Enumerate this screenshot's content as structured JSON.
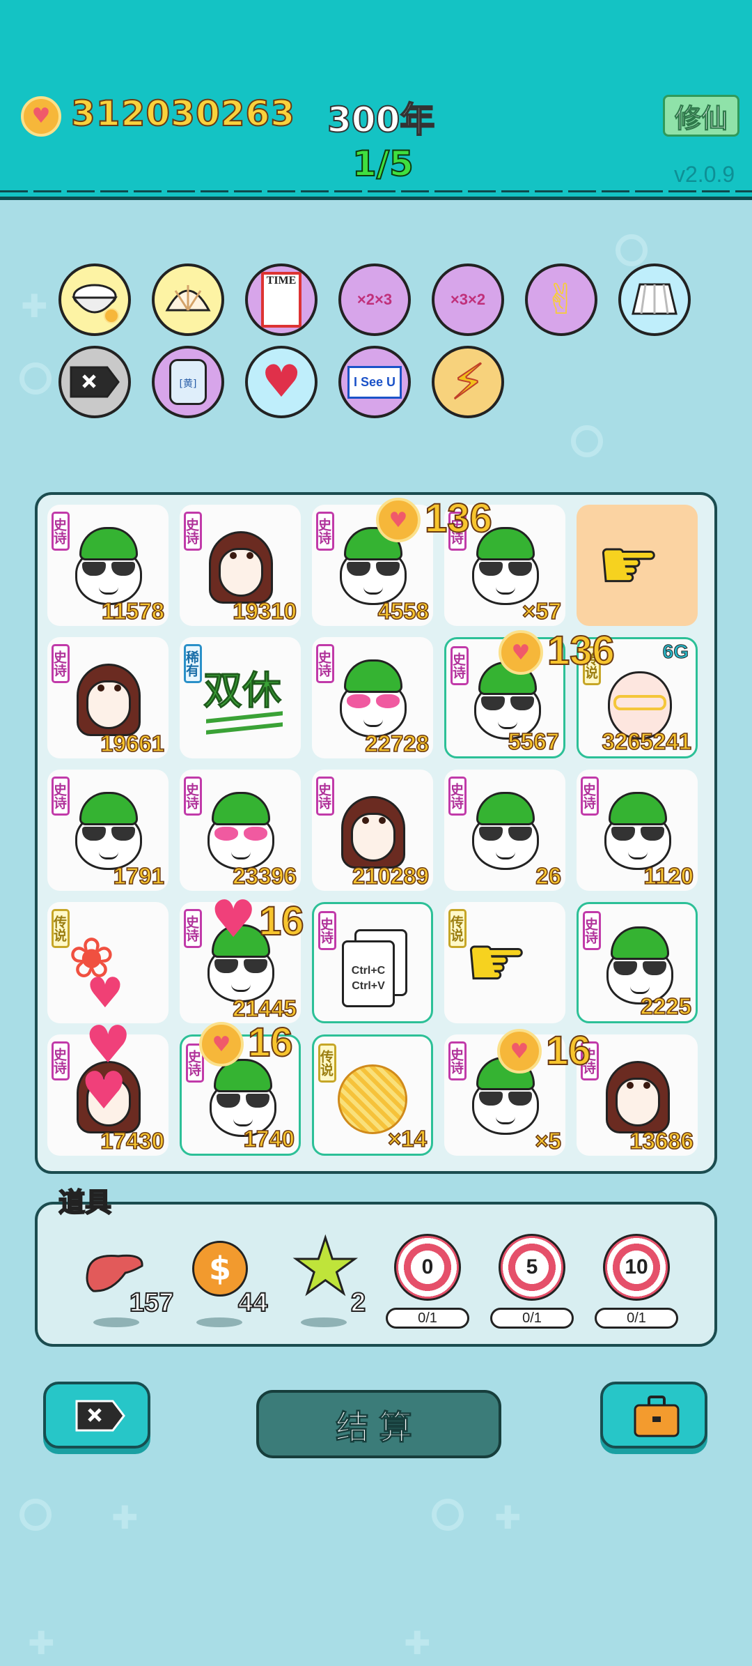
{
  "header": {
    "coins": "312030263",
    "year": "300年",
    "progress": "1/5",
    "cultivate_label": "修仙",
    "version": "v2.0.9"
  },
  "items_row1": [
    "rice-bowl-icon",
    "shell-icon",
    "time-magazine-icon",
    "multiplier-grandpa-icon",
    "multiplier-grandpa-icon",
    "rock-hand-icon",
    "skirt-icon"
  ],
  "items_row2": [
    "delete-tag-icon",
    "jar-icon",
    "heart-fan-icon",
    "i-see-u-icon",
    "lightning-icon"
  ],
  "item_labels": {
    "jar": "[黄]",
    "i_see_u": "I See U",
    "time": "TIME"
  },
  "board": {
    "tag_epic": "史诗",
    "tag_legend": "传说",
    "tag_rare": "稀有",
    "tiles": [
      {
        "kind": "grandpa",
        "value": "11578"
      },
      {
        "kind": "girl",
        "value": "19310"
      },
      {
        "kind": "grandpa",
        "value": "4558"
      },
      {
        "kind": "grandpa",
        "value": "×57"
      },
      {
        "kind": "empty-hand",
        "value": ""
      },
      {
        "kind": "girl",
        "value": "19661"
      },
      {
        "kind": "double-rest",
        "value": "双休"
      },
      {
        "kind": "grandpa-pink",
        "value": "22728"
      },
      {
        "kind": "grandpa",
        "value": "5567"
      },
      {
        "kind": "bald",
        "value": "3265241"
      },
      {
        "kind": "grandpa",
        "value": "1791"
      },
      {
        "kind": "grandpa-pink",
        "value": "23396"
      },
      {
        "kind": "girl",
        "value": "210289"
      },
      {
        "kind": "grandpa",
        "value": "26"
      },
      {
        "kind": "grandpa",
        "value": "1120"
      },
      {
        "kind": "fish",
        "value": ""
      },
      {
        "kind": "grandpa",
        "value": "21445"
      },
      {
        "kind": "ctrl-cards",
        "value": ""
      },
      {
        "kind": "hand",
        "value": ""
      },
      {
        "kind": "grandpa",
        "value": "2225"
      },
      {
        "kind": "girl",
        "value": "17430"
      },
      {
        "kind": "grandpa",
        "value": "1740"
      },
      {
        "kind": "noodles",
        "value": "×14"
      },
      {
        "kind": "grandpa",
        "value": "×5"
      },
      {
        "kind": "girl",
        "value": "13686"
      }
    ],
    "ctrl_c": "Ctrl+C",
    "ctrl_v": "Ctrl+V",
    "six_g": "6G",
    "floats": [
      "136",
      "136",
      "16",
      "16",
      "16"
    ]
  },
  "props": {
    "title": "道具",
    "liver_count": "157",
    "coin_count": "44",
    "star_count": "2",
    "targets": [
      {
        "label": "0",
        "count": "0/1"
      },
      {
        "label": "5",
        "count": "0/1"
      },
      {
        "label": "10",
        "count": "0/1"
      }
    ]
  },
  "settle_label": "结算",
  "colors": {
    "header_bg": "#14c3c4",
    "page_bg": "#a9dde6",
    "value_text": "#f7c52e"
  }
}
